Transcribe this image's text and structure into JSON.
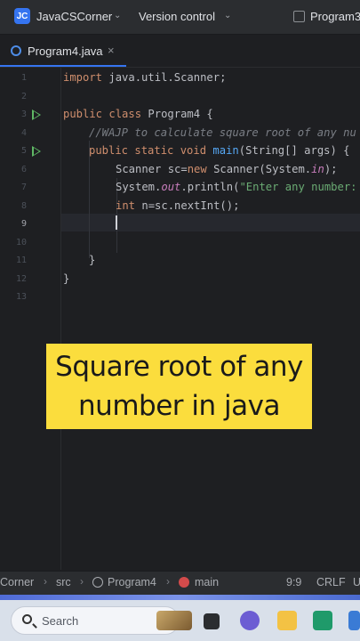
{
  "titlebar": {
    "project_badge": "JC",
    "project_name": "JavaCSCorner",
    "version_control": "Version control",
    "run_config": "Program3"
  },
  "tabs": [
    {
      "label": "Program4.java",
      "close": "×"
    }
  ],
  "editor": {
    "line_numbers": [
      "1",
      "2",
      "3",
      "4",
      "5",
      "6",
      "7",
      "8",
      "9",
      "10",
      "11",
      "12",
      "13"
    ],
    "current_line": "9",
    "lines": {
      "l1_kw": "import",
      "l1_rest": " java.util.Scanner;",
      "l3_kw": "public class",
      "l3_rest": " Program4 {",
      "l4_comment": "//WAJP to calculate square root of any nu",
      "l5_kw": "public static void",
      "l5_fn": " main",
      "l5_rest": "(String[] args) {",
      "l6_a": "Scanner sc=",
      "l6_kw": "new",
      "l6_b": " Scanner(System.",
      "l6_it": "in",
      "l6_c": ");",
      "l7_a": "System.",
      "l7_it": "out",
      "l7_b": ".println(",
      "l7_st": "\"Enter any number:",
      "l8_kw": "int",
      "l8_rest": " n=sc.nextInt();",
      "l11": "}",
      "l12": "}"
    }
  },
  "overlay": {
    "line1": "Square root of any",
    "line2": "number in java"
  },
  "statusbar": {
    "crumb_project": "Corner",
    "crumb_src": "src",
    "crumb_class": "Program4",
    "crumb_method": "main",
    "position": "9:9",
    "line_sep": "CRLF",
    "encoding": "U"
  },
  "taskbar": {
    "search_placeholder": "Search"
  },
  "colors": {
    "accent": "#3574f0",
    "overlay_bg": "#fbdd3d",
    "keyword": "#cf8e6d",
    "function": "#56a8f5",
    "string": "#6aab73"
  }
}
